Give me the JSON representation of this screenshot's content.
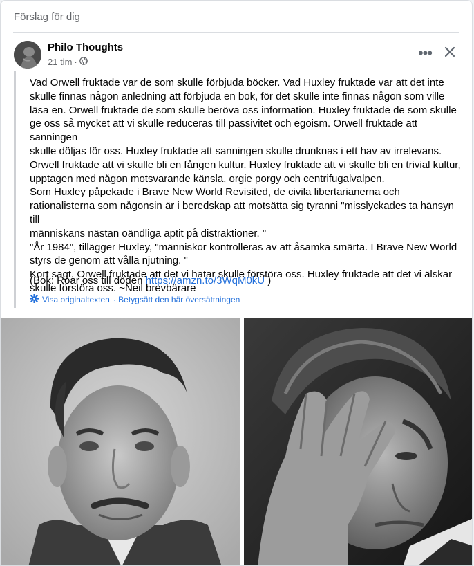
{
  "section_title": "Förslag för dig",
  "post": {
    "author": "Philo Thoughts",
    "time": "21 tim",
    "separator": "·",
    "privacy_icon": "globe-icon",
    "more_label": "•••",
    "body_lines": [
      "Vad Orwell fruktade var de som skulle förbjuda böcker. Vad Huxley fruktade var att det inte",
      "skulle finnas någon anledning att förbjuda en bok, för det skulle inte finnas någon som ville",
      "läsa en. Orwell fruktade de som skulle beröva oss information. Huxley fruktade de som skulle",
      "ge oss så mycket att vi skulle reduceras till passivitet och egoism. Orwell fruktade att sanningen",
      "skulle döljas för oss. Huxley fruktade att sanningen skulle drunknas i ett hav av irrelevans.",
      "Orwell fruktade att vi skulle bli en fången kultur. Huxley fruktade att vi skulle bli en trivial kultur,",
      "upptagen med någon motsvarande känsla, orgie porgy och centrifugalvalpen.",
      "Som Huxley påpekade i Brave New World Revisited, de civila libertarianerna och",
      "rationalisterna som någonsin är i beredskap att motsätta sig tyranni \"misslyckades ta hänsyn till",
      "människans nästan oändliga aptit på distraktioner. \"",
      "\"År 1984\", tillägger Huxley, \"människor kontrolleras av att åsamka smärta. I Brave New World",
      "styrs de genom att vålla njutning. \"",
      "Kort sagt, Orwell fruktade att det vi hatar skulle förstöra oss. Huxley fruktade att det vi älskar",
      "skulle förstöra oss. ~Neil brevbärare"
    ],
    "book_prefix": "(Bok: Roar oss till döden ",
    "book_link": "https://amzn.to/3WqM0kU",
    "book_suffix": " )",
    "translate_original": "Visa originaltexten",
    "translate_rate": "· Betygsätt den här översättningen"
  },
  "colors": {
    "link": "#216fdb",
    "secondary_text": "#65676b",
    "quote_bar": "#ced0d4"
  }
}
